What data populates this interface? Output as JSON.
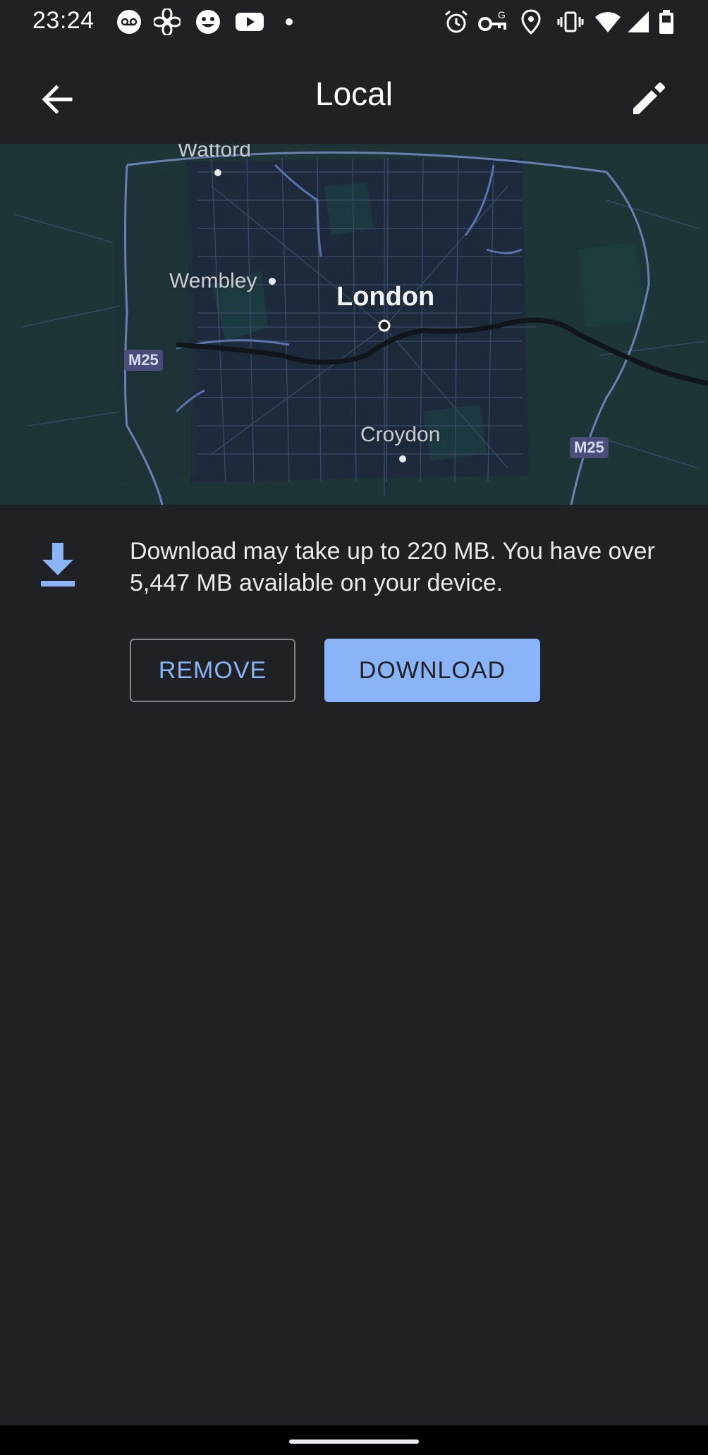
{
  "status_bar": {
    "time": "23:24",
    "icons_left": [
      "voicemail-icon",
      "fan-icon",
      "smiley-icon",
      "youtube-icon",
      "dot-icon"
    ],
    "icons_right": [
      "alarm-icon",
      "vpn-key-icon",
      "location-icon",
      "vibrate-icon",
      "wifi-icon",
      "signal-icon",
      "battery-icon"
    ]
  },
  "app_bar": {
    "title": "Local",
    "back_icon": "arrow-back-icon",
    "edit_icon": "pencil-icon"
  },
  "map": {
    "labels": {
      "watford": "Watford",
      "wembley": "Wembley",
      "london": "London",
      "croydon": "Croydon",
      "m25_left": "M25",
      "m25_right": "M25"
    }
  },
  "download_info": {
    "icon": "download-icon",
    "text": "Download may take up to 220 MB. You have over 5,447 MB available on your device."
  },
  "buttons": {
    "remove": "REMOVE",
    "download": "DOWNLOAD"
  },
  "colors": {
    "background": "#202124",
    "accent": "#8ab4f8",
    "map_base": "#1f3a3d"
  }
}
